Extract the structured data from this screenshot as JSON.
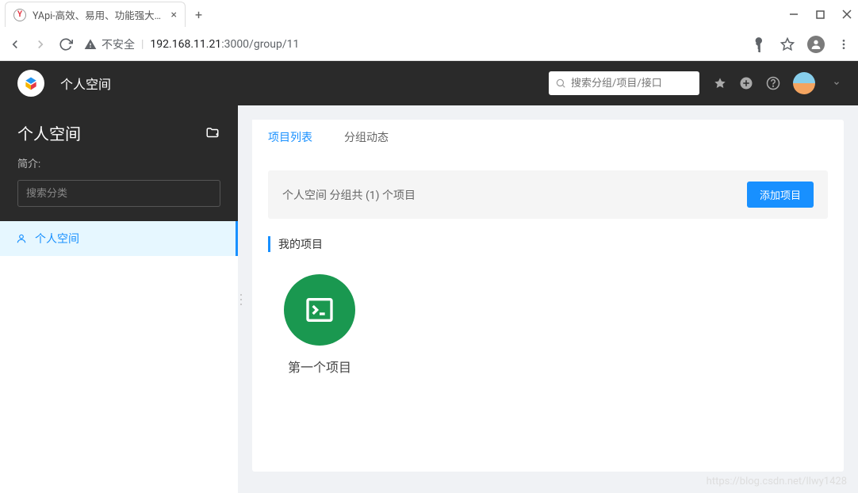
{
  "browser": {
    "tab_title": "YApi-高效、易用、功能强大的可",
    "url_insecure_label": "不安全",
    "url_host": "192.168.11.21",
    "url_port_path": ":3000/group/11"
  },
  "header": {
    "title": "个人空间",
    "search_placeholder": "搜索分组/项目/接口"
  },
  "sidebar": {
    "title": "个人空间",
    "intro_label": "简介:",
    "search_placeholder": "搜索分类",
    "items": [
      {
        "label": "个人空间"
      }
    ]
  },
  "main": {
    "tabs": [
      {
        "label": "项目列表",
        "active": true
      },
      {
        "label": "分组动态",
        "active": false
      }
    ],
    "info_text": "个人空间 分组共 (1) 个项目",
    "add_project_label": "添加项目",
    "section_title": "我的项目",
    "projects": [
      {
        "name": "第一个项目"
      }
    ]
  },
  "watermark": "https://blog.csdn.net/llwy1428"
}
